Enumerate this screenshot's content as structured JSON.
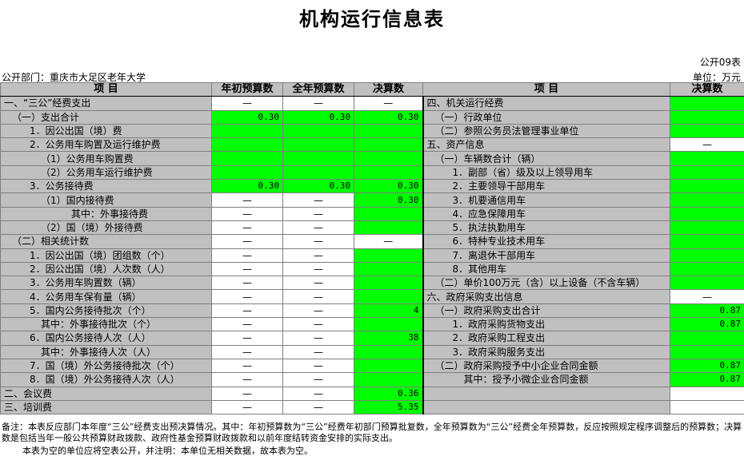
{
  "title": "机构运行信息表",
  "form_no": "公开09表",
  "department": "公开部门：重庆市大足区老年大学",
  "unit": "单位：万元",
  "headers": {
    "left_item": "项   目",
    "initial_budget": "年初预算数",
    "full_year_budget": "全年预算数",
    "final": "决算数",
    "right_item": "项   目",
    "right_final": "决算数"
  },
  "rows": [
    {
      "l": "一、“三公”经费支出",
      "lind": 0,
      "a": "—",
      "b": "—",
      "c": "—",
      "ac": "w",
      "bc": "w",
      "cc": "w",
      "r": "四、机关运行经费",
      "rind": 0,
      "rv": "",
      "rc": "g"
    },
    {
      "l": "（一）支出合计",
      "lind": 1,
      "a": "0.30",
      "b": "0.30",
      "c": "0.30",
      "ac": "g",
      "bc": "g",
      "cc": "g",
      "r": "（一）行政单位",
      "rind": 1,
      "rv": "",
      "rc": "g"
    },
    {
      "l": "1．因公出国（境）费",
      "lind": 2,
      "a": "",
      "b": "",
      "c": "",
      "ac": "g",
      "bc": "g",
      "cc": "g",
      "r": "（二）参照公务员法管理事业单位",
      "rind": 1,
      "rv": "",
      "rc": "g"
    },
    {
      "l": "2．公务用车购置及运行维护费",
      "lind": 2,
      "a": "",
      "b": "",
      "c": "",
      "ac": "g",
      "bc": "g",
      "cc": "g",
      "r": "五、资产信息",
      "rind": 0,
      "rv": "—",
      "rc": "w"
    },
    {
      "l": "（1）公务用车购置费",
      "lind": 3,
      "a": "",
      "b": "",
      "c": "",
      "ac": "g",
      "bc": "g",
      "cc": "g",
      "r": "（一）车辆数合计（辆）",
      "rind": 1,
      "rv": "",
      "rc": "g"
    },
    {
      "l": "（2）公务用车运行维护费",
      "lind": 3,
      "a": "",
      "b": "",
      "c": "",
      "ac": "g",
      "bc": "g",
      "cc": "g",
      "r": "1．副部（省）级及以上领导用车",
      "rind": 2,
      "rv": "",
      "rc": "g"
    },
    {
      "l": "3．公务接待费",
      "lind": 2,
      "a": "0.30",
      "b": "0.30",
      "c": "0.30",
      "ac": "g",
      "bc": "g",
      "cc": "g",
      "r": "2．主要领导干部用车",
      "rind": 2,
      "rv": "",
      "rc": "g"
    },
    {
      "l": "（1）国内接待费",
      "lind": 3,
      "a": "—",
      "b": "—",
      "c": "0.30",
      "ac": "w",
      "bc": "w",
      "cc": "g",
      "r": "3．机要通信用车",
      "rind": 2,
      "rv": "",
      "rc": "g"
    },
    {
      "l": "其中：外事接待费",
      "lind": 4,
      "a": "—",
      "b": "—",
      "c": "",
      "ac": "w",
      "bc": "w",
      "cc": "g",
      "r": "4．应急保障用车",
      "rind": 2,
      "rv": "",
      "rc": "g"
    },
    {
      "l": "（2）国（境）外接待费",
      "lind": 3,
      "a": "—",
      "b": "—",
      "c": "",
      "ac": "w",
      "bc": "w",
      "cc": "g",
      "r": "5．执法执勤用车",
      "rind": 2,
      "rv": "",
      "rc": "g"
    },
    {
      "l": "（二）相关统计数",
      "lind": 1,
      "a": "—",
      "b": "—",
      "c": "—",
      "ac": "w",
      "bc": "w",
      "cc": "w",
      "r": "6．特种专业技术用车",
      "rind": 2,
      "rv": "",
      "rc": "g"
    },
    {
      "l": "1．因公出国（境）团组数（个）",
      "lind": 2,
      "a": "—",
      "b": "—",
      "c": "",
      "ac": "w",
      "bc": "w",
      "cc": "g",
      "r": "7．离退休干部用车",
      "rind": 2,
      "rv": "",
      "rc": "g"
    },
    {
      "l": "2．因公出国（境）人次数（人）",
      "lind": 2,
      "a": "—",
      "b": "—",
      "c": "",
      "ac": "w",
      "bc": "w",
      "cc": "g",
      "r": "8．其他用车",
      "rind": 2,
      "rv": "",
      "rc": "g"
    },
    {
      "l": "3．公务用车购置数（辆）",
      "lind": 2,
      "a": "—",
      "b": "—",
      "c": "",
      "ac": "w",
      "bc": "w",
      "cc": "g",
      "r": "（二）单价100万元（含）以上设备（不含车辆）",
      "rind": 1,
      "rv": "",
      "rc": "g"
    },
    {
      "l": "4．公务用车保有量（辆）",
      "lind": 2,
      "a": "—",
      "b": "—",
      "c": "",
      "ac": "w",
      "bc": "w",
      "cc": "g",
      "r": "六、政府采购支出信息",
      "rind": 0,
      "rv": "—",
      "rc": "w"
    },
    {
      "l": "5．国内公务接待批次（个）",
      "lind": 2,
      "a": "—",
      "b": "—",
      "c": "4",
      "ac": "w",
      "bc": "w",
      "cc": "g",
      "r": "（一）政府采购支出合计",
      "rind": 1,
      "rv": "0.87",
      "rc": "g"
    },
    {
      "l": "其中：外事接待批次（个）",
      "lind": 3,
      "a": "—",
      "b": "—",
      "c": "",
      "ac": "w",
      "bc": "w",
      "cc": "g",
      "r": "1．政府采购货物支出",
      "rind": 2,
      "rv": "0.87",
      "rc": "g"
    },
    {
      "l": "6．国内公务接待人次（人）",
      "lind": 2,
      "a": "—",
      "b": "—",
      "c": "38",
      "ac": "w",
      "bc": "w",
      "cc": "g",
      "r": "2．政府采购工程支出",
      "rind": 2,
      "rv": "",
      "rc": "g"
    },
    {
      "l": "其中：外事接待人次（人）",
      "lind": 3,
      "a": "—",
      "b": "—",
      "c": "",
      "ac": "w",
      "bc": "w",
      "cc": "g",
      "r": "3．政府采购服务支出",
      "rind": 2,
      "rv": "",
      "rc": "g"
    },
    {
      "l": "7．国（境）外公务接待批次（个）",
      "lind": 2,
      "a": "—",
      "b": "—",
      "c": "",
      "ac": "w",
      "bc": "w",
      "cc": "g",
      "r": "（二）政府采购授予中小企业合同金额",
      "rind": 1,
      "rv": "0.87",
      "rc": "g"
    },
    {
      "l": "8．国（境）外公务接待人次（人）",
      "lind": 2,
      "a": "—",
      "b": "—",
      "c": "",
      "ac": "w",
      "bc": "w",
      "cc": "g",
      "r": "其中：授予小微企业合同金额",
      "rind": 3,
      "rv": "0.87",
      "rc": "g"
    },
    {
      "l": "二、会议费",
      "lind": 0,
      "a": "—",
      "b": "—",
      "c": "0.36",
      "ac": "w",
      "bc": "w",
      "cc": "g",
      "r": "",
      "rind": 0,
      "rv": "",
      "rc": "w"
    },
    {
      "l": "三、培训费",
      "lind": 0,
      "a": "—",
      "b": "—",
      "c": "5.35",
      "ac": "w",
      "bc": "w",
      "cc": "g",
      "r": "",
      "rind": 0,
      "rv": "",
      "rc": "w"
    }
  ],
  "notes": {
    "line1": "备注：本表反应部门本年度“三公”经费支出预决算情况。其中：年初预算数为“三公”经费年初部门预算批复数，全年预算数为“三公”经费全年预算数，反应按照规定程序调整后的预算数；决算数是包括当年一般公共预算财政拨款、政府性基金预算财政拨款和以前年度结转资金安排的实际支出。",
    "line2": "本表为空的单位应将空表公开，并注明：本单位无相关数据，故本表为空。"
  },
  "colors": {
    "green": "#00ff00",
    "label_grey": "#c0c0c0",
    "white": "#ffffff"
  }
}
